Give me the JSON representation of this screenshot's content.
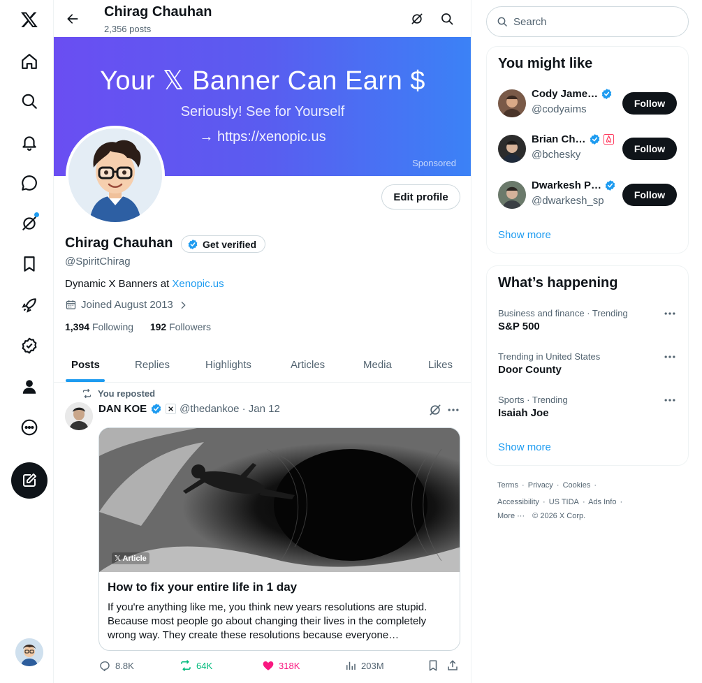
{
  "header": {
    "name": "Chirag Chauhan",
    "posts_count": "2,356 posts"
  },
  "banner": {
    "headline": "Your 𝕏 Banner Can Earn $",
    "sub": "Seriously! See for Yourself",
    "url": "→ https://xenopic.us",
    "sponsored": "Sponsored"
  },
  "profile": {
    "edit_label": "Edit profile",
    "name": "Chirag Chauhan",
    "get_verified": "Get verified",
    "handle": "@SpiritChirag",
    "bio_prefix": "Dynamic X Banners at ",
    "bio_link": "Xenopic.us",
    "joined": "Joined August 2013",
    "following_count": "1,394",
    "following_label": "Following",
    "followers_count": "192",
    "followers_label": "Followers"
  },
  "tabs": [
    "Posts",
    "Replies",
    "Highlights",
    "Articles",
    "Media",
    "Likes"
  ],
  "tweet": {
    "repost_label": "You reposted",
    "author_name": "DAN KOE",
    "author_handle_date": "@thedankoe · Jan 12",
    "article_tag": "𝕏 Article",
    "card_title": "How to fix your entire life in 1 day",
    "card_text": "If you're anything like me, you think new years resolutions are stupid. Because most people go about changing their lives in the completely wrong way. They create these resolutions because everyone…",
    "replies": "8.8K",
    "reposts": "64K",
    "likes": "318K",
    "views": "203M"
  },
  "search": {
    "placeholder": "Search"
  },
  "you_might_like": {
    "title": "You might like",
    "users": [
      {
        "name": "Cody Jame…",
        "handle": "@codyaims",
        "follow": "Follow"
      },
      {
        "name": "Brian Ch…",
        "handle": "@bchesky",
        "follow": "Follow"
      },
      {
        "name": "Dwarkesh P…",
        "handle": "@dwarkesh_sp",
        "follow": "Follow"
      }
    ],
    "show_more": "Show more"
  },
  "whats_happening": {
    "title": "What’s happening",
    "trends": [
      {
        "category": "Business and finance · Trending",
        "name": "S&P 500"
      },
      {
        "category": "Trending in United States",
        "name": "Door County"
      },
      {
        "category": "Sports · Trending",
        "name": "Isaiah Joe"
      }
    ],
    "show_more": "Show more"
  },
  "footer": {
    "line1": [
      "Terms",
      "·",
      "Privacy",
      "·",
      "Cookies",
      "·"
    ],
    "line2": [
      "Accessibility",
      "·",
      "US TIDA",
      "·",
      "Ads Info",
      "·"
    ],
    "line3": [
      "More ···",
      "© 2026 X Corp."
    ]
  },
  "colors": {
    "accent": "#1d9bf0",
    "repost_green": "#00ba7c",
    "like_pink": "#f91880",
    "banner_start": "#6a4ef2",
    "banner_end": "#3b82f6"
  },
  "icons": {
    "nav": [
      "x-logo-icon",
      "home-icon",
      "search-icon",
      "bell-icon",
      "message-icon",
      "grok-icon",
      "bookmark-icon",
      "rocket-icon",
      "verified-icon",
      "profile-icon",
      "more-circle-icon",
      "compose-icon"
    ]
  }
}
